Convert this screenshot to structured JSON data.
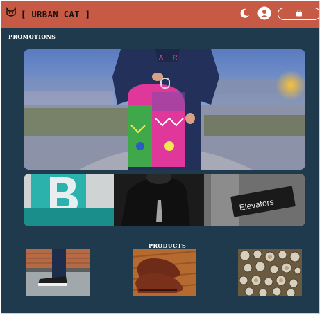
{
  "header": {
    "brand_name": "[ URBAN CAT ]",
    "logo_icon": "cat-logo-icon",
    "theme_icon": "moon-icon",
    "account_icon": "user-icon",
    "cart_icon": "shopping-bag-icon"
  },
  "promotions": {
    "title": "PROMOTIONS",
    "banners": [
      {
        "name": "promo-banner-backpack",
        "image": "person holding colorful backpack"
      },
      {
        "name": "promo-banner-elevators",
        "image": "person in black tee near Elevators sign"
      }
    ],
    "elevators_sign": "Elevators"
  },
  "products": {
    "title": "PRODUCTS",
    "items": [
      {
        "image": "jeans and sneakers on brick"
      },
      {
        "image": "brown leather shoes"
      },
      {
        "image": "pile of watches"
      }
    ]
  },
  "colors": {
    "header": "#c65a45",
    "background": "#1f3a4d"
  }
}
